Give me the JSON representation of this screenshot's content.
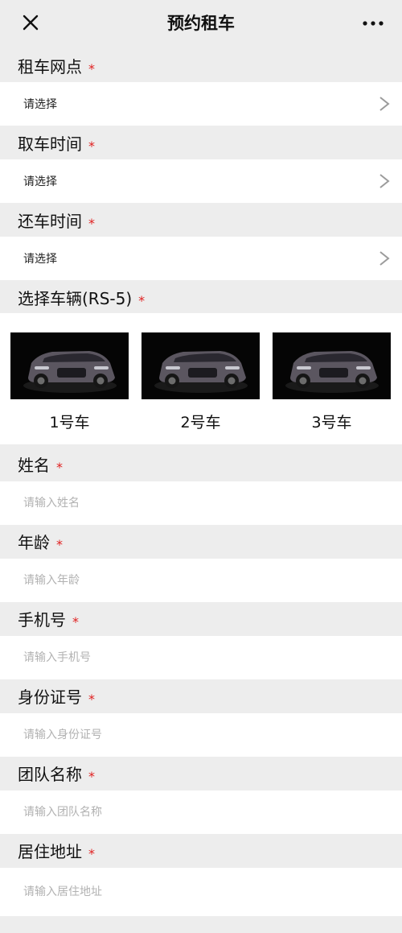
{
  "nav": {
    "title": "预约租车",
    "close_icon": "close-icon",
    "more_icon": "more-icon"
  },
  "required_mark": "*",
  "fields": {
    "branch": {
      "label": "租车网点",
      "value": "请选择"
    },
    "pickup_time": {
      "label": "取车时间",
      "value": "请选择"
    },
    "return_time": {
      "label": "还车时间",
      "value": "请选择"
    },
    "vehicle": {
      "label": "选择车辆(RS-5)",
      "options": [
        {
          "label": "1号车"
        },
        {
          "label": "2号车"
        },
        {
          "label": "3号车"
        }
      ]
    },
    "name": {
      "label": "姓名",
      "placeholder": "请输入姓名",
      "value": ""
    },
    "age": {
      "label": "年龄",
      "placeholder": "请输入年龄",
      "value": ""
    },
    "phone": {
      "label": "手机号",
      "placeholder": "请输入手机号",
      "value": ""
    },
    "id_number": {
      "label": "身份证号",
      "placeholder": "请输入身份证号",
      "value": ""
    },
    "team_name": {
      "label": "团队名称",
      "placeholder": "请输入团队名称",
      "value": ""
    },
    "address": {
      "label": "居住地址",
      "placeholder": "请输入居住地址",
      "value": ""
    }
  },
  "colors": {
    "background": "#ededed",
    "required": "#e02020",
    "placeholder": "#b2b2b2"
  }
}
